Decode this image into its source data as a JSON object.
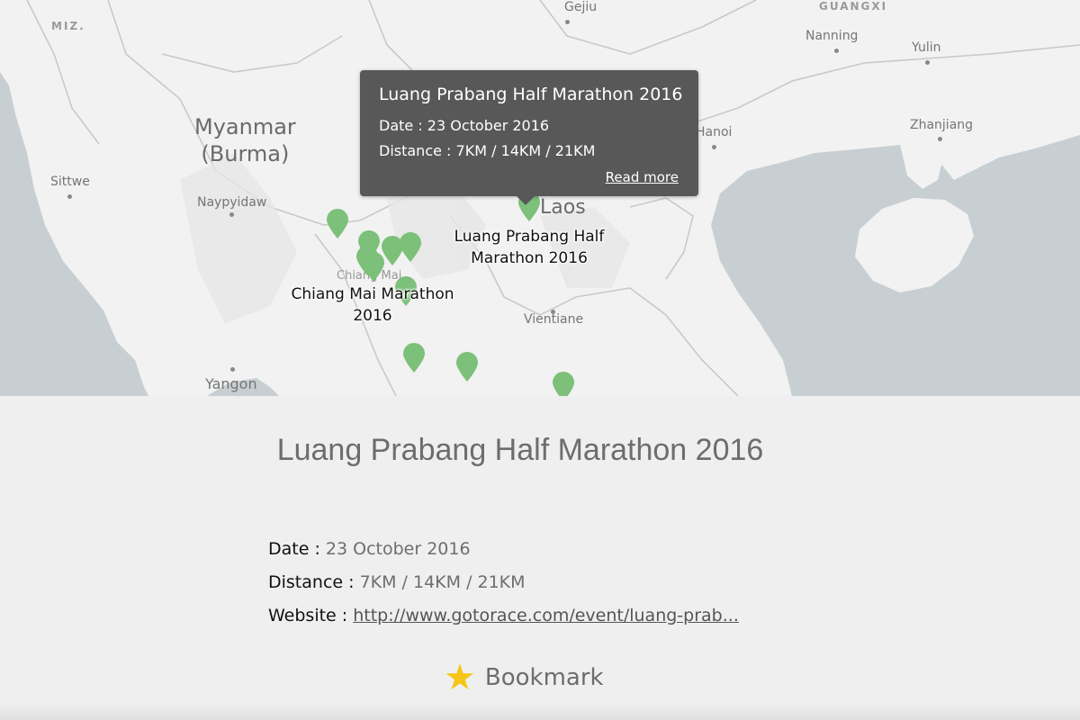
{
  "map": {
    "countries": {
      "myanmar": "Myanmar\n(Burma)",
      "laos": "Laos"
    },
    "regions": {
      "miz": "MIZ.",
      "guangxi": "GUANGXI"
    },
    "cities": {
      "gejiu": "Gejiu",
      "nanning": "Nanning",
      "yulin": "Yulin",
      "hanoi": "Hanoi",
      "zhanjiang": "Zhanjiang",
      "sittwe": "Sittwe",
      "naypyidaw": "Naypyidaw",
      "chiang_mai": "Chiang Mai",
      "vientiane": "Vientiane",
      "yangon": "Yangon"
    },
    "marker_labels": {
      "luang": "Luang Prabang Half\nMarathon 2016",
      "chiang": "Chiang Mai Marathon\n2016"
    },
    "marker_color": "#7cc07a",
    "water_color": "#c8cfd3",
    "land_color": "#f2f2f2"
  },
  "popup": {
    "title": "Luang Prabang Half Marathon 2016",
    "date": "Date : 23 October 2016",
    "distance": "Distance : 7KM / 14KM / 21KM",
    "read_more": "Read more"
  },
  "event": {
    "title": "Luang Prabang Half Marathon 2016",
    "date_label": "Date :",
    "date_value": "23 October 2016",
    "distance_label": "Distance :",
    "distance_value": "7KM / 14KM / 21KM",
    "website_label": "Website :",
    "website_value": "http://www.gotorace.com/event/luang-prab..."
  },
  "bookmark": {
    "label": "Bookmark",
    "icon": "star-icon",
    "icon_color": "#f5c518"
  }
}
